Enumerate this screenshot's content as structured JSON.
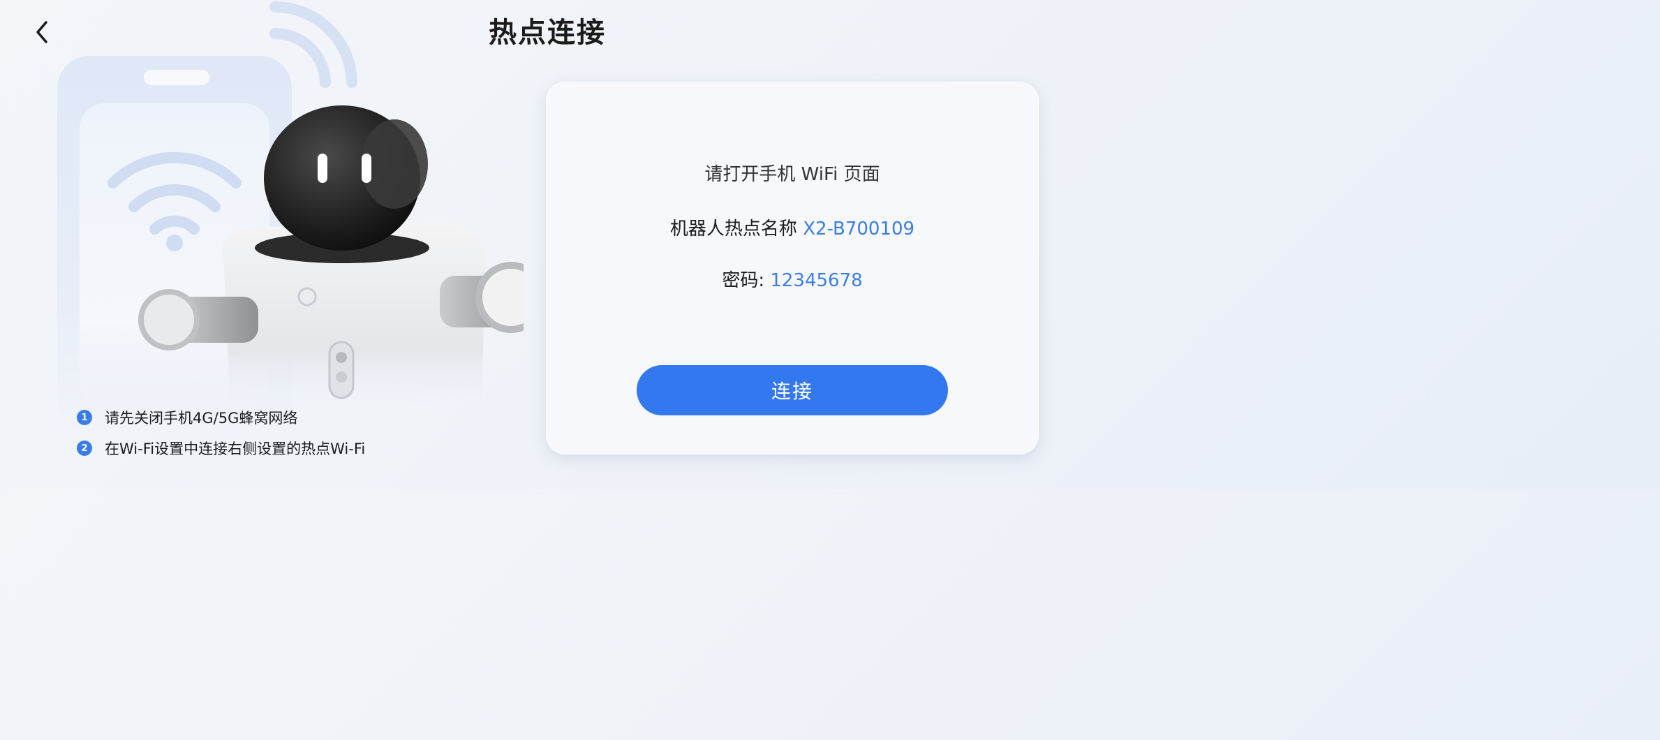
{
  "header": {
    "title": "热点连接",
    "back_icon": "chevron-left-icon"
  },
  "card": {
    "instruction": "请打开手机 WiFi 页面",
    "hotspot_label": "机器人热点名称",
    "hotspot_name": "X2-B700109",
    "password_label": "密码:",
    "password": "12345678",
    "connect_button": "连接"
  },
  "steps": [
    {
      "number": "1",
      "text": "请先关闭手机4G/5G蜂窝网络"
    },
    {
      "number": "2",
      "text": "在Wi-Fi设置中连接右侧设置的热点Wi-Fi"
    }
  ],
  "colors": {
    "accent": "#3478f0",
    "highlight_text": "#3a7de8",
    "background": "#eef2f8"
  },
  "illustration": {
    "subject": "robot-and-phone-wifi-illustration"
  }
}
